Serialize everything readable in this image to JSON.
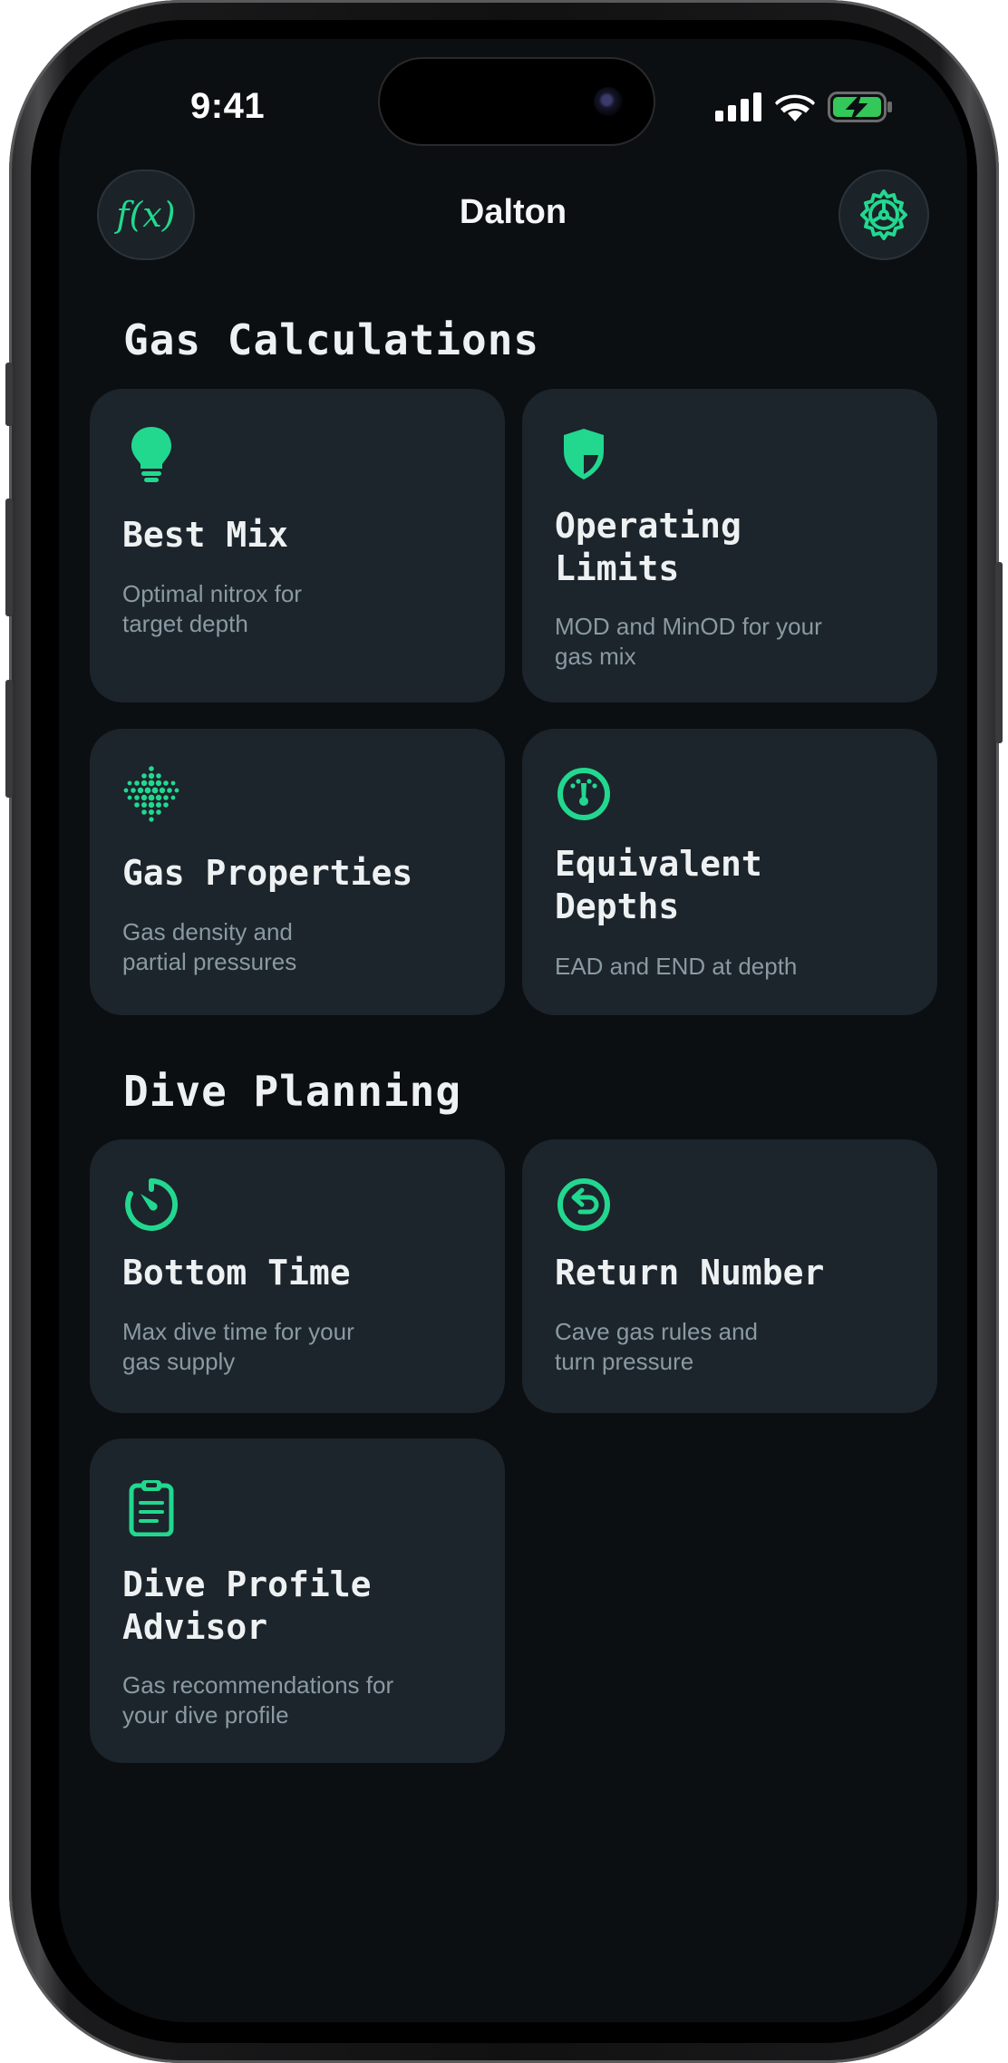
{
  "status_bar": {
    "time": "9:41"
  },
  "nav": {
    "title": "Dalton",
    "left_button_icon": "function-fx-icon",
    "left_button_text": "f(x)",
    "right_button_icon": "gear-icon"
  },
  "colors": {
    "accent": "#22d88f",
    "background": "#0c0f12",
    "card": "#1c242c",
    "subtitle": "#8a9aa2"
  },
  "sections": {
    "gas": {
      "title": "Gas Calculations",
      "cards": [
        {
          "icon": "lightbulb-icon",
          "title": "Best Mix",
          "subtitle": "Optimal nitrox for\ntarget depth"
        },
        {
          "icon": "shield-icon",
          "title": "Operating\nLimits",
          "subtitle": "MOD and MinOD for your\ngas mix"
        },
        {
          "icon": "dot-grid-icon",
          "title": "Gas Properties",
          "subtitle": "Gas density and\npartial pressures"
        },
        {
          "icon": "gauge-icon",
          "title": "Equivalent\nDepths",
          "subtitle": "EAD and END at depth"
        }
      ]
    },
    "planning": {
      "title": "Dive Planning",
      "cards": [
        {
          "icon": "timer-icon",
          "title": "Bottom Time",
          "subtitle": "Max dive time for your\ngas supply"
        },
        {
          "icon": "return-arrow-icon",
          "title": "Return Number",
          "subtitle": "Cave gas rules and\nturn pressure"
        },
        {
          "icon": "clipboard-icon",
          "title": "Dive Profile\nAdvisor",
          "subtitle": "Gas recommendations for\nyour dive profile"
        }
      ]
    }
  }
}
